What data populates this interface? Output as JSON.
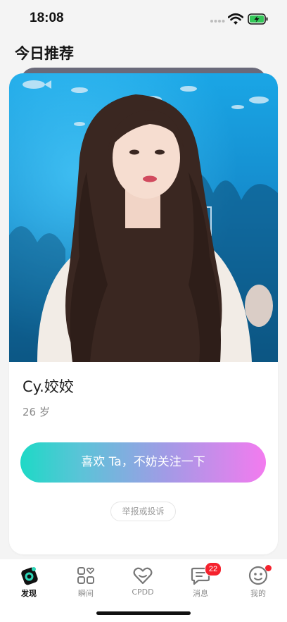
{
  "status_bar": {
    "time": "18:08",
    "icons": [
      "signal-dots",
      "wifi-icon",
      "battery-charging-icon"
    ],
    "battery_color": "#34c759"
  },
  "section": {
    "title": "今日推荐"
  },
  "card": {
    "photo": "portrait-photo",
    "name": "Cy.姣姣",
    "age": "26 岁",
    "like_button_label": "喜欢 Ta，不妨关注一下",
    "report_button_label": "举报或投诉",
    "like_gradient": [
      "#1ed9c6",
      "#a39ae6",
      "#f37bef"
    ]
  },
  "tab_bar": {
    "tabs": [
      {
        "label": "发现",
        "icon": "discover-icon",
        "active": true
      },
      {
        "label": "瞬间",
        "icon": "moments-grid-icon",
        "active": false
      },
      {
        "label": "CPDD",
        "icon": "heart-icon",
        "active": false
      },
      {
        "label": "消息",
        "icon": "message-icon",
        "active": false,
        "badge": "22"
      },
      {
        "label": "我的",
        "icon": "profile-icon",
        "active": false,
        "dot": true
      }
    ]
  },
  "colors": {
    "badge": "#f5222d",
    "active_tab": "#111111",
    "inactive_tab": "#8b8b8b"
  }
}
